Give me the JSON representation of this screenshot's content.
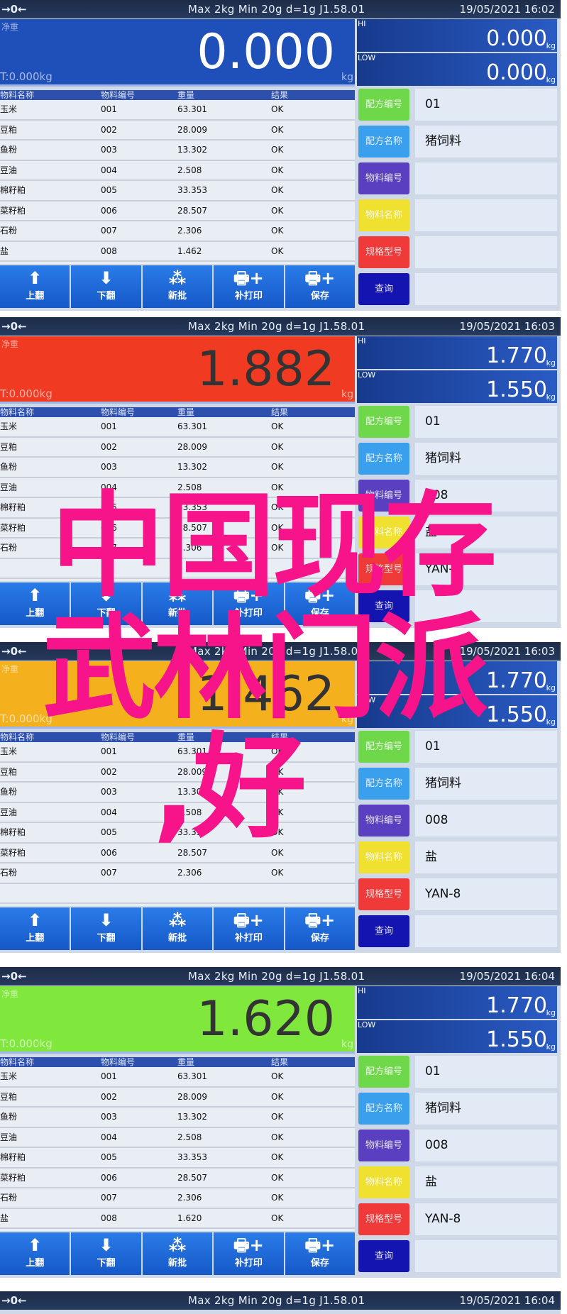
{
  "header": {
    "status": "→0←",
    "spec": "Max 2kg  Min 20g  d=1g    J1.58.01"
  },
  "labels": {
    "net": "净重",
    "tare": "T:0.000kg",
    "unit": "kg",
    "hi": "HI",
    "low": "LOW",
    "limit_unit": "kg"
  },
  "table_headers": [
    "物料名称",
    "物料编号",
    "重量",
    "结果"
  ],
  "buttons": [
    {
      "icon": "arrow-up",
      "label": "上翻"
    },
    {
      "icon": "arrow-down",
      "label": "下翻"
    },
    {
      "icon": "stack",
      "label": "新批"
    },
    {
      "icon": "printer-plus",
      "label": "补打印"
    },
    {
      "icon": "printer-plus",
      "label": "保存"
    }
  ],
  "side_buttons": [
    {
      "label": "配方编号",
      "color": "#6fd84a"
    },
    {
      "label": "配方名称",
      "color": "#3aa0ee"
    },
    {
      "label": "物料编号",
      "color": "#5a3fc0"
    },
    {
      "label": "物料名称",
      "color": "#f0e030"
    },
    {
      "label": "规格型号",
      "color": "#f03a3a"
    },
    {
      "label": "查询",
      "color": "#1414b0"
    }
  ],
  "panels": [
    {
      "datetime": "19/05/2021  16:02",
      "weight": "0.000",
      "display_color": "#1f4fb8",
      "hi": "0.000",
      "low": "0.000",
      "rows": [
        [
          "玉米",
          "001",
          "63.301",
          "OK"
        ],
        [
          "豆粕",
          "002",
          "28.009",
          "OK"
        ],
        [
          "鱼粉",
          "003",
          "13.302",
          "OK"
        ],
        [
          "豆油",
          "004",
          "2.508",
          "OK"
        ],
        [
          "棉籽粕",
          "005",
          "33.353",
          "OK"
        ],
        [
          "菜籽粕",
          "006",
          "28.507",
          "OK"
        ],
        [
          "石粉",
          "007",
          "2.306",
          "OK"
        ],
        [
          "盐",
          "008",
          "1.462",
          "OK"
        ]
      ],
      "values": [
        "01",
        "猪饲料",
        "",
        "",
        ""
      ]
    },
    {
      "datetime": "19/05/2021  16:03",
      "weight": "1.882",
      "display_color": "#f03a22",
      "hi": "1.770",
      "low": "1.550",
      "rows": [
        [
          "玉米",
          "001",
          "63.301",
          "OK"
        ],
        [
          "豆粕",
          "002",
          "28.009",
          "OK"
        ],
        [
          "鱼粉",
          "003",
          "13.302",
          "OK"
        ],
        [
          "豆油",
          "004",
          "2.508",
          "OK"
        ],
        [
          "棉籽粕",
          "005",
          "33.353",
          "OK"
        ],
        [
          "菜籽粕",
          "006",
          "28.507",
          "OK"
        ],
        [
          "石粉",
          "007",
          "2.306",
          "OK"
        ]
      ],
      "values": [
        "01",
        "猪饲料",
        "008",
        "盐",
        "YAN-8"
      ]
    },
    {
      "datetime": "19/05/2021  16:03",
      "weight": "1.462",
      "display_color": "#f5b01e",
      "hi": "1.770",
      "low": "1.550",
      "rows": [
        [
          "玉米",
          "001",
          "63.301",
          "OK"
        ],
        [
          "豆粕",
          "002",
          "28.009",
          "OK"
        ],
        [
          "鱼粉",
          "003",
          "13.302",
          "OK"
        ],
        [
          "豆油",
          "004",
          "2.508",
          "OK"
        ],
        [
          "棉籽粕",
          "005",
          "33.353",
          "OK"
        ],
        [
          "菜籽粕",
          "006",
          "28.507",
          "OK"
        ],
        [
          "石粉",
          "007",
          "2.306",
          "OK"
        ]
      ],
      "values": [
        "01",
        "猪饲料",
        "008",
        "盐",
        "YAN-8"
      ]
    },
    {
      "datetime": "19/05/2021  16:04",
      "weight": "1.620",
      "display_color": "#80e83c",
      "hi": "1.770",
      "low": "1.550",
      "rows": [
        [
          "玉米",
          "001",
          "63.301",
          "OK"
        ],
        [
          "豆粕",
          "002",
          "28.009",
          "OK"
        ],
        [
          "鱼粉",
          "003",
          "13.302",
          "OK"
        ],
        [
          "豆油",
          "004",
          "2.508",
          "OK"
        ],
        [
          "棉籽粕",
          "005",
          "33.353",
          "OK"
        ],
        [
          "菜籽粕",
          "006",
          "28.507",
          "OK"
        ],
        [
          "石粉",
          "007",
          "2.306",
          "OK"
        ],
        [
          "盐",
          "008",
          "1.620",
          "OK"
        ]
      ],
      "values": [
        "01",
        "猪饲料",
        "008",
        "盐",
        "YAN-8"
      ]
    }
  ],
  "bottom_strip": {
    "datetime": "19/05/2021  16:04"
  },
  "overlay": {
    "line1": "中国现存",
    "line2": "武林门派",
    "line3": ",好",
    "color": "#f7148a"
  }
}
